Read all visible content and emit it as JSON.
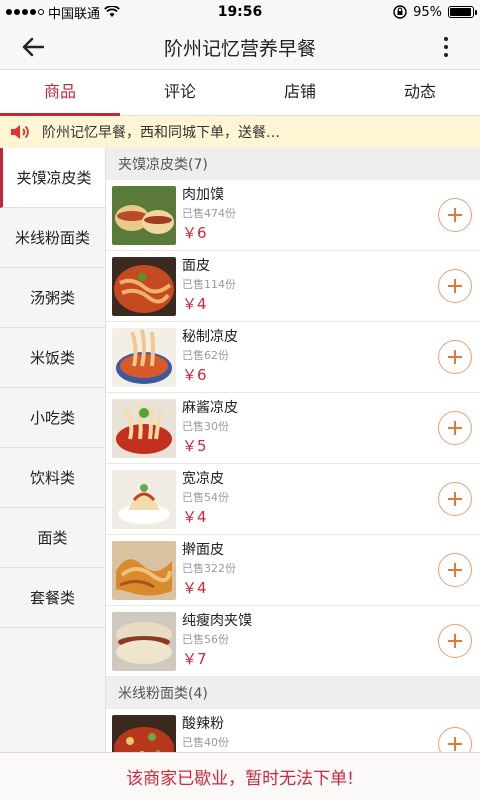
{
  "status_bar": {
    "carrier": "中国联通",
    "time": "19:56",
    "battery": "95%",
    "battery_level": 0.95
  },
  "header": {
    "title": "阶州记忆营养早餐"
  },
  "tabs": [
    {
      "label": "商品"
    },
    {
      "label": "评论"
    },
    {
      "label": "店铺"
    },
    {
      "label": "动态"
    }
  ],
  "notice": {
    "text": "阶州记忆早餐，西和同城下单，送餐…"
  },
  "categories": [
    {
      "label": "夹馍凉皮类"
    },
    {
      "label": "米线粉面类"
    },
    {
      "label": "汤粥类"
    },
    {
      "label": "米饭类"
    },
    {
      "label": "小吃类"
    },
    {
      "label": "饮料类"
    },
    {
      "label": "面类"
    },
    {
      "label": "套餐类"
    }
  ],
  "sections": [
    {
      "title": "夹馍凉皮类(7)",
      "products": [
        {
          "name": "肉加馍",
          "sold": "已售474份",
          "price": "￥6"
        },
        {
          "name": "面皮",
          "sold": "已售114份",
          "price": "￥4"
        },
        {
          "name": "秘制凉皮",
          "sold": "已售62份",
          "price": "￥6"
        },
        {
          "name": "麻酱凉皮",
          "sold": "已售30份",
          "price": "￥5"
        },
        {
          "name": "宽凉皮",
          "sold": "已售54份",
          "price": "￥4"
        },
        {
          "name": "擀面皮",
          "sold": "已售322份",
          "price": "￥4"
        },
        {
          "name": "纯瘦肉夹馍",
          "sold": "已售56份",
          "price": "￥7"
        }
      ]
    },
    {
      "title": "米线粉面类(4)",
      "products": [
        {
          "name": "酸辣粉",
          "sold": "已售40份",
          "price": ""
        }
      ]
    }
  ],
  "footer": {
    "closed_text": "该商家已歇业，暂时无法下单!"
  },
  "colors": {
    "accent": "#c0283a",
    "price": "#d0283a",
    "notice_bg": "#fdf5d3",
    "add_button_border": "#e6a07a"
  }
}
